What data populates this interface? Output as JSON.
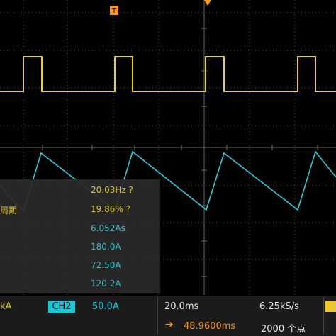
{
  "trigger_marker": "T",
  "measurements": [
    {
      "label": "",
      "value": "20.03Hz ?",
      "channel": "ch1"
    },
    {
      "label": "周期",
      "value": "19.86% ?",
      "channel": "ch1"
    },
    {
      "label": "",
      "value": "6.052As",
      "channel": "ch2"
    },
    {
      "label": "",
      "value": "180.0A",
      "channel": "ch2"
    },
    {
      "label": "",
      "value": "72.50A",
      "channel": "ch2"
    },
    {
      "label": "",
      "value": "120.2A",
      "channel": "ch2"
    }
  ],
  "status_bar": {
    "ch1_scale": "kA",
    "ch2_label": "CH2",
    "ch2_scale": "50.0A",
    "timebase": "20.0ms",
    "sample_rate": "6.25kS/s",
    "horizontal_position": "48.9600ms",
    "record_length": "2000 个点"
  },
  "colors": {
    "ch1": "#e8d22a",
    "ch2": "#2ccbd5",
    "grid": "#5a5a5a",
    "trigger": "#f39a1f"
  }
}
